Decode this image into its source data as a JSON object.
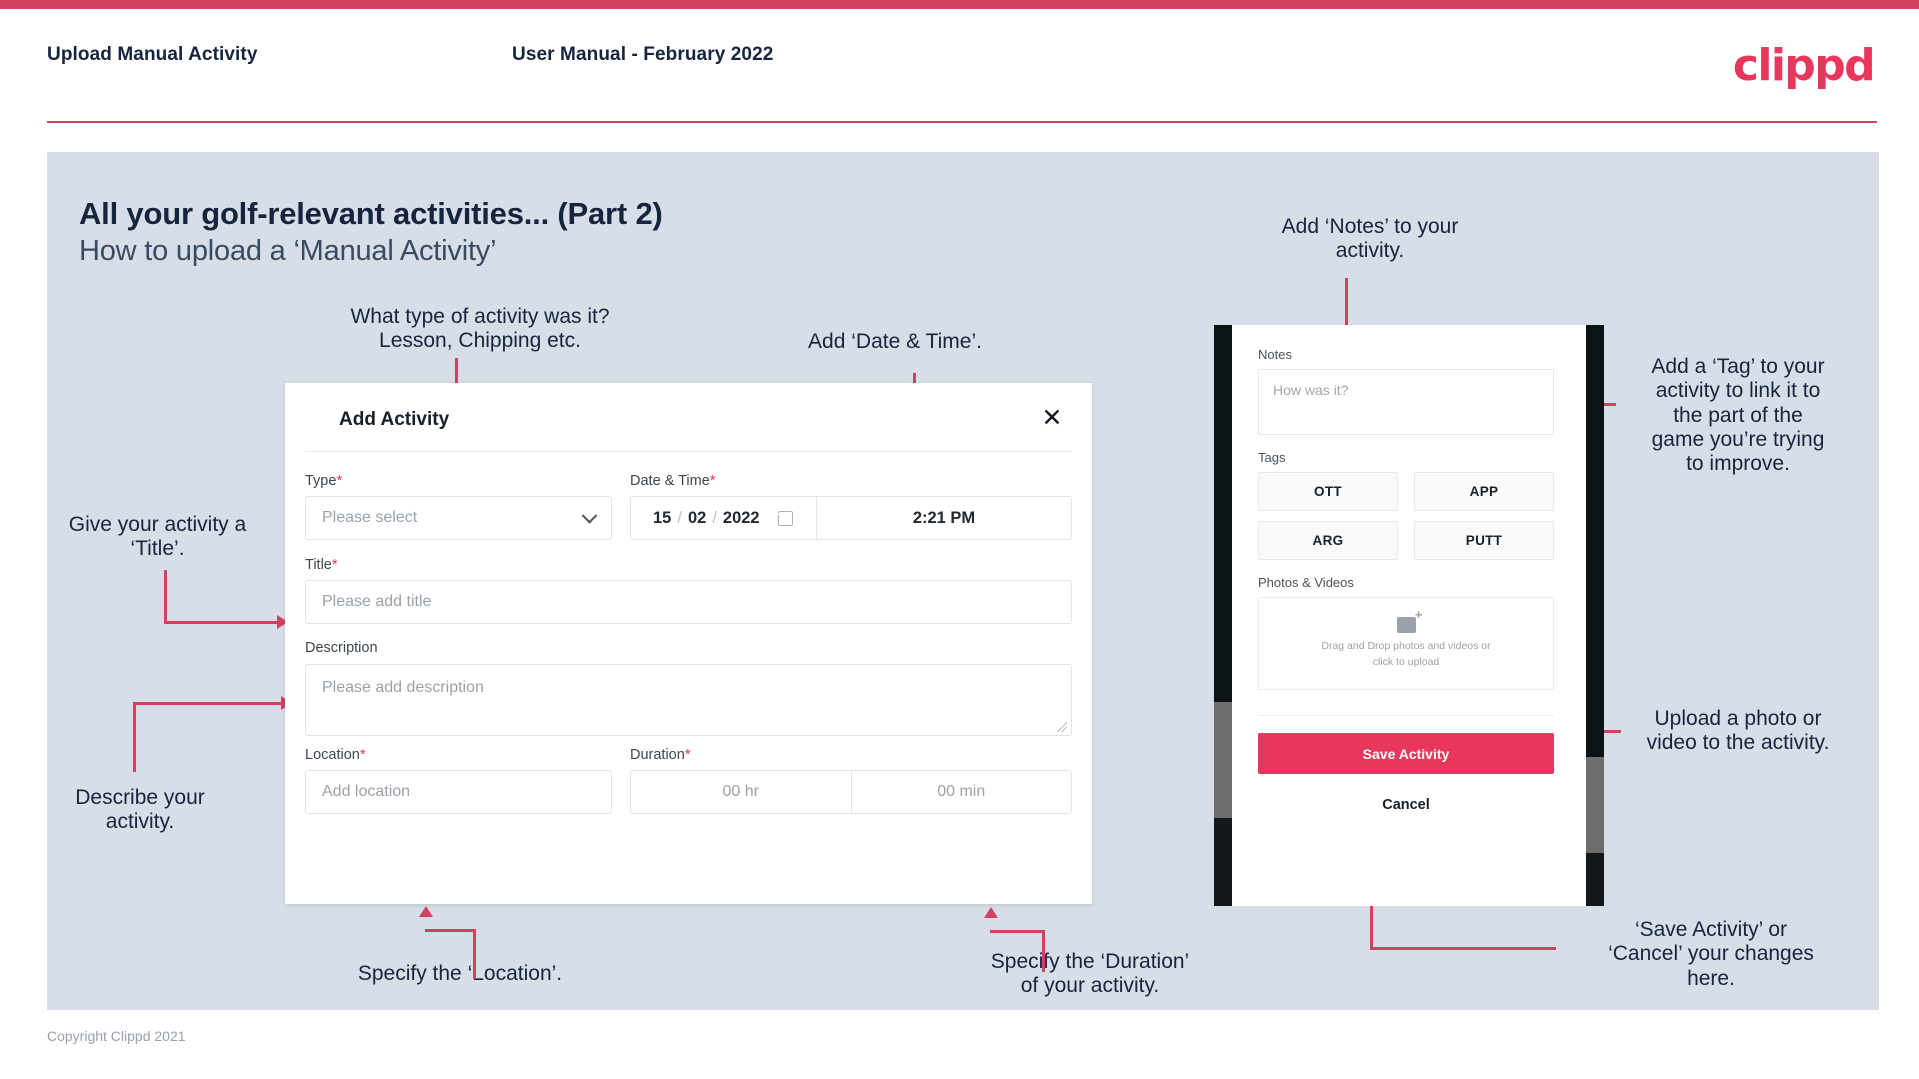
{
  "header": {
    "title": "Upload Manual Activity",
    "subtitle": "User Manual - February 2022",
    "logo": "clippd"
  },
  "slide": {
    "heading": "All your golf-relevant activities... (Part 2)",
    "subheading": "How to upload a ‘Manual Activity’"
  },
  "annotations": {
    "type": "What type of activity was it?\nLesson, Chipping etc.",
    "datetime": "Add ‘Date & Time’.",
    "title": "Give your activity a\n‘Title’.",
    "description": "Describe your\nactivity.",
    "location": "Specify the ‘Location’.",
    "duration": "Specify the ‘Duration’\nof your activity.",
    "notes": "Add ‘Notes’ to your\nactivity.",
    "tags": "Add a ‘Tag’ to your\nactivity to link it to\nthe part of the\ngame you’re trying\nto improve.",
    "photos": "Upload a photo or\nvideo to the activity.",
    "save": "‘Save Activity’ or\n‘Cancel’ your changes\nhere."
  },
  "dialog": {
    "title": "Add Activity",
    "close_icon": "close-icon",
    "fields": {
      "type": {
        "label": "Type",
        "required": "*",
        "value": "Please select",
        "chevron_icon": "chevron-down-icon"
      },
      "datetime": {
        "label": "Date & Time",
        "required": "*",
        "day": "15",
        "sep1": "/",
        "month": "02",
        "sep2": "/",
        "year": "2022",
        "calendar_icon": "calendar-icon",
        "time": "2:21 PM"
      },
      "title": {
        "label": "Title",
        "required": "*",
        "placeholder": "Please add title"
      },
      "description": {
        "label": "Description",
        "placeholder": "Please add description"
      },
      "location": {
        "label": "Location",
        "required": "*",
        "placeholder": "Add location"
      },
      "duration": {
        "label": "Duration",
        "required": "*",
        "hours": "00 hr",
        "minutes": "00 min"
      }
    }
  },
  "phone": {
    "notes": {
      "label": "Notes",
      "placeholder": "How was it?"
    },
    "tags": {
      "label": "Tags",
      "items": [
        "OTT",
        "APP",
        "ARG",
        "PUTT"
      ]
    },
    "photos": {
      "label": "Photos & Videos",
      "upload_icon": "add-image-icon",
      "text": "Drag and Drop photos and videos or\nclick to upload"
    },
    "save_label": "Save Activity",
    "cancel_label": "Cancel"
  },
  "footer": {
    "copyright": "Copyright Clippd 2021"
  },
  "colors": {
    "brand_pink": "#e8365d",
    "accent_crimson": "#cf4360",
    "slide_bg": "#d7dee7",
    "ink": "#16243d"
  }
}
